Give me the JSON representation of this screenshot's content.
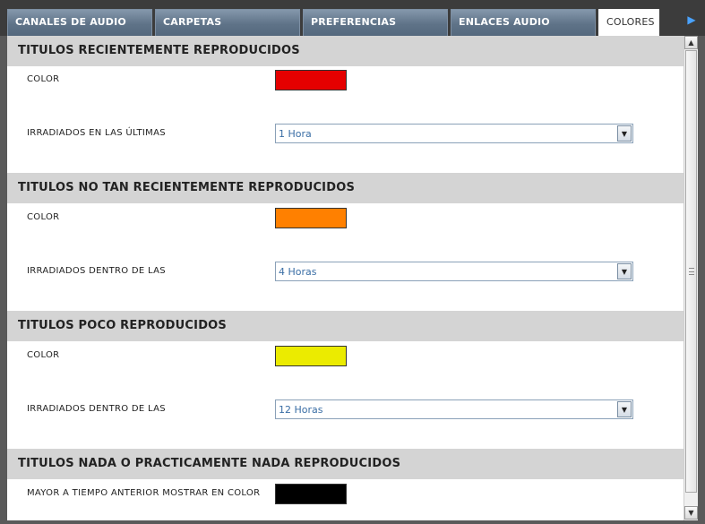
{
  "tabs": [
    {
      "label": "CANALES DE AUDIO"
    },
    {
      "label": "CARPETAS"
    },
    {
      "label": "PREFERENCIAS"
    },
    {
      "label": "ENLACES AUDIO"
    },
    {
      "label": "COLORES DE"
    }
  ],
  "active_tab": "COLORES DE",
  "icons": {
    "tab_scroll": "chevron-right-icon",
    "dropdown": "chevron-down-icon"
  },
  "sections": [
    {
      "title": "TITULOS RECIENTEMENTE REPRODUCIDOS",
      "color_label": "COLOR",
      "color": "#e50000",
      "period_label": "IRRADIADOS EN LAS ÚLTIMAS",
      "period_value": "1 Hora"
    },
    {
      "title": "TITULOS NO TAN RECIENTEMENTE REPRODUCIDOS",
      "color_label": "COLOR",
      "color": "#ff8000",
      "period_label": "IRRADIADOS DENTRO DE LAS",
      "period_value": "4 Horas"
    },
    {
      "title": "TITULOS POCO REPRODUCIDOS",
      "color_label": "COLOR",
      "color": "#ebeb00",
      "period_label": "IRRADIADOS DENTRO DE LAS",
      "period_value": "12 Horas"
    },
    {
      "title": "TITULOS NADA O PRACTICAMENTE NADA REPRODUCIDOS",
      "color_label": "MAYOR A TIEMPO ANTERIOR MOSTRAR EN COLOR",
      "color": "#000000"
    }
  ]
}
